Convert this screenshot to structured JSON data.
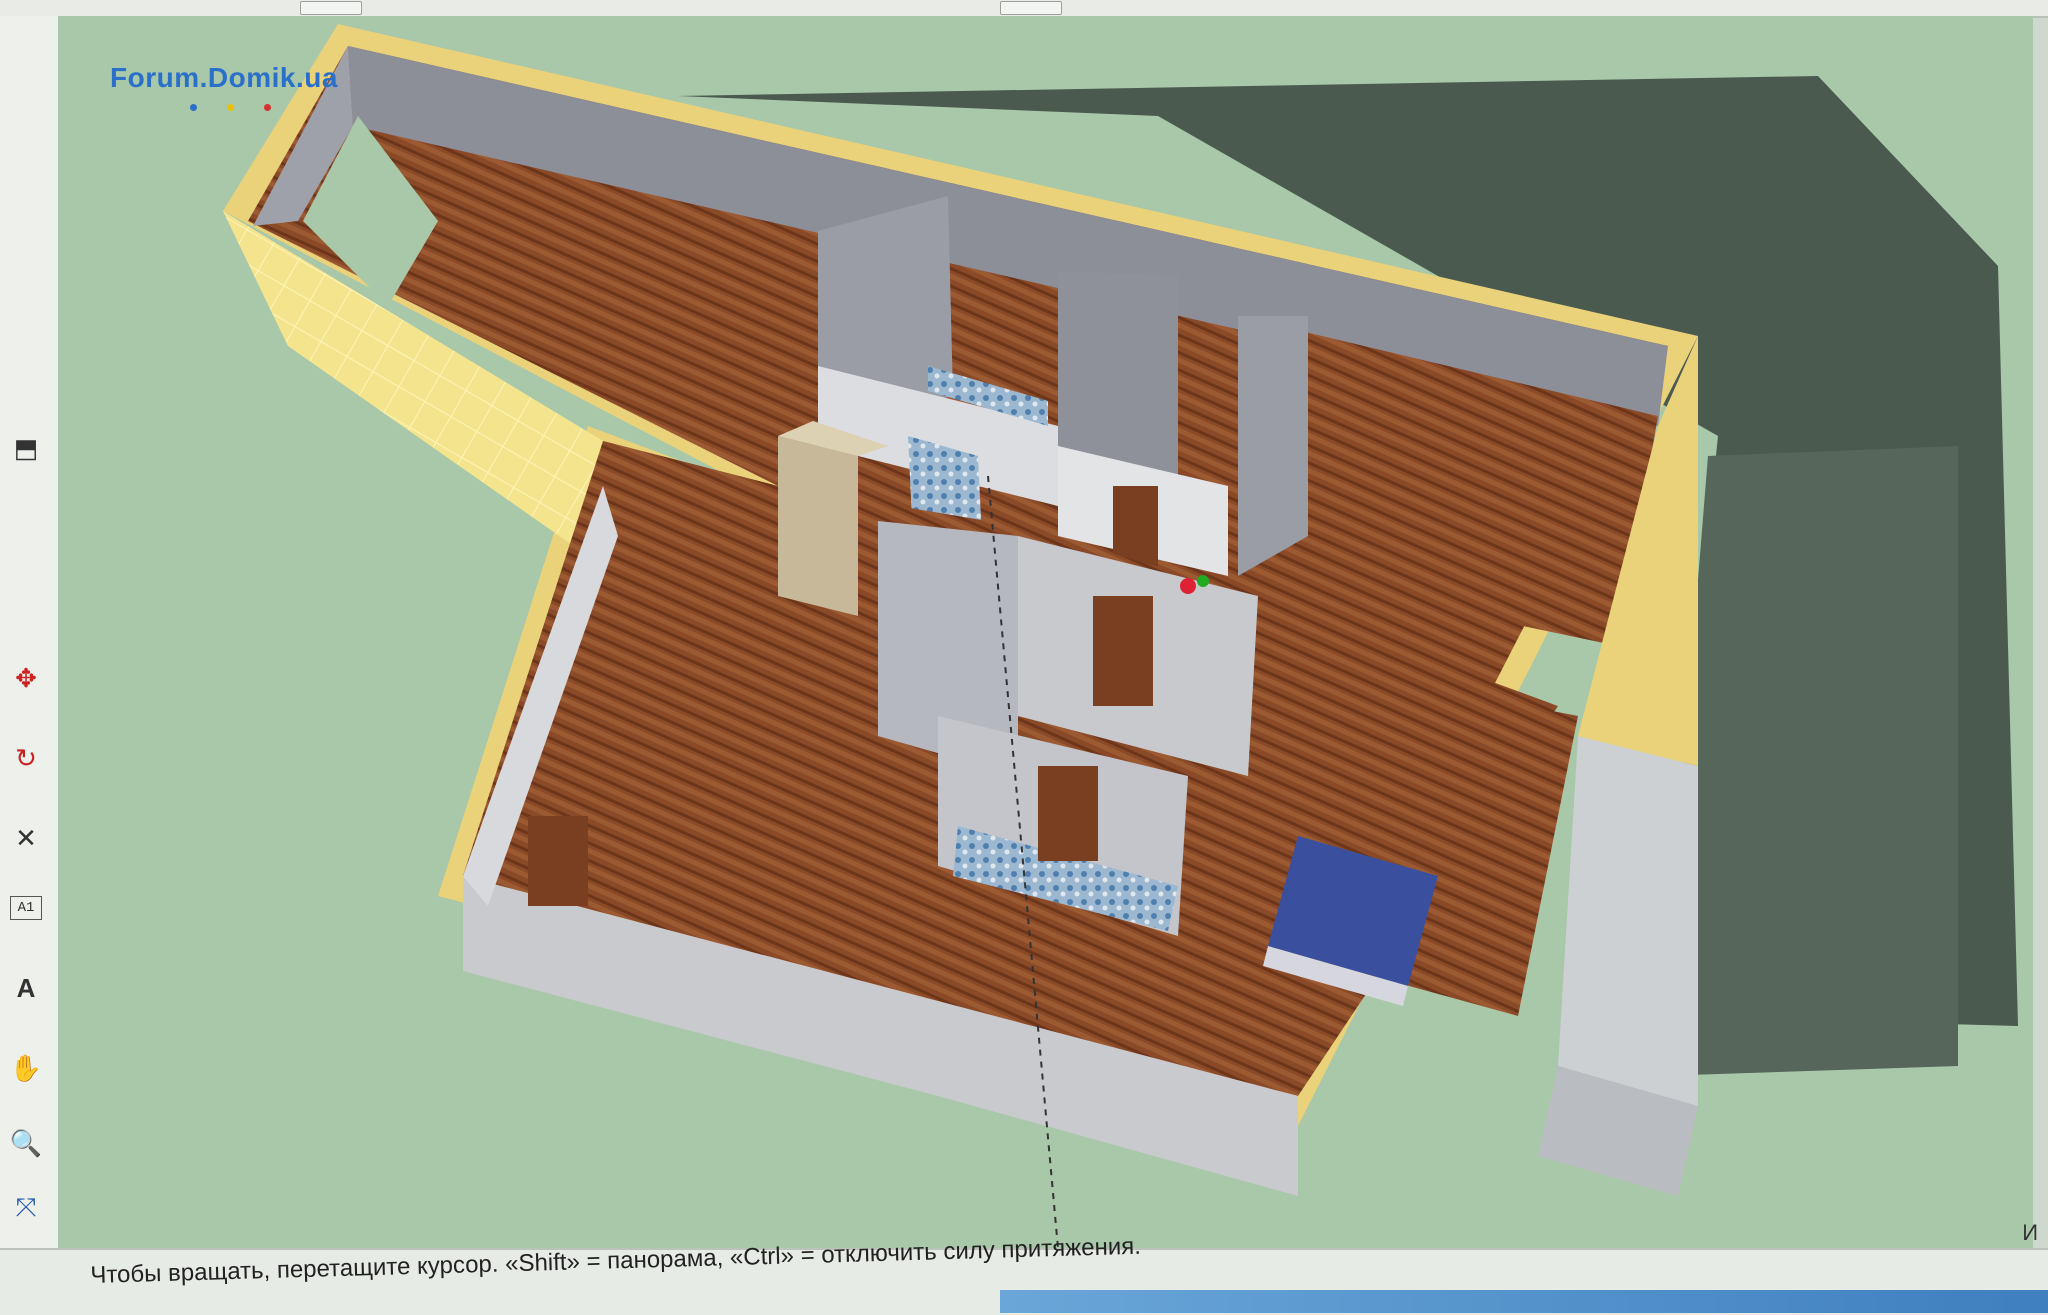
{
  "watermark": {
    "text": "Forum.Domik.ua",
    "dot_colors": [
      "#2a70c8",
      "#e8c200",
      "#d83030"
    ]
  },
  "statusbar": {
    "hint": "Чтобы вращать, перетащите курсор. «Shift» = панорама, «Ctrl» = отключить силу притяжения.",
    "side": "И"
  },
  "toolbar": {
    "tools": [
      {
        "name": "tool-push-pull-icon"
      },
      {
        "name": "tool-move-icon"
      },
      {
        "name": "tool-rotate-icon"
      },
      {
        "name": "tool-axes-icon"
      },
      {
        "name": "tool-text-icon",
        "label": "A1"
      },
      {
        "name": "tool-3d-text-icon",
        "label": "A"
      },
      {
        "name": "tool-pan-icon"
      },
      {
        "name": "tool-zoom-icon"
      },
      {
        "name": "tool-zoom-extents-icon"
      },
      {
        "name": "tool-look-around-icon"
      }
    ]
  },
  "colors": {
    "ground": "#a9c7a9",
    "shadow": "#4a5a4e",
    "wall": "#c9cacd",
    "wall_top": "#e9d27a",
    "floor": "#8a4a28",
    "tile": "#7ba1c2",
    "bed": "#3a4f9e"
  }
}
